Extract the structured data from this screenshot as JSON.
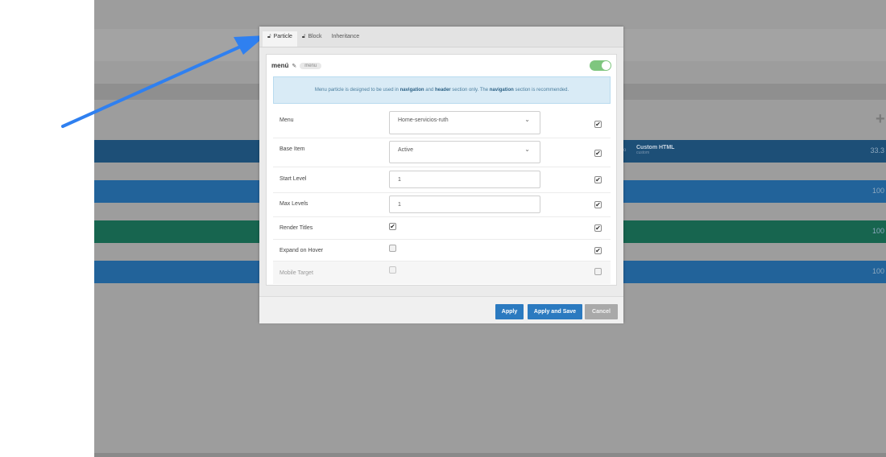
{
  "background": {
    "custom_html_title": "Custom HTML",
    "custom_html_sub": "custom",
    "cut_label": "o",
    "plus": "+",
    "row_values": [
      "33.3",
      "100",
      "100",
      "100"
    ]
  },
  "tabs": [
    {
      "label": "Particle",
      "icon": "lock-icon",
      "active": true
    },
    {
      "label": "Block",
      "icon": "lock-icon",
      "active": false
    },
    {
      "label": "Inheritance",
      "active": false
    }
  ],
  "header": {
    "title": "menú",
    "badge": "menu",
    "enabled": true
  },
  "info": {
    "prefix": "Menu particle is designed to be used in ",
    "b1": "navigation",
    "mid1": " and ",
    "b2": "header",
    "mid2": " section only. The ",
    "b3": "navigation",
    "suffix": " section is recommended."
  },
  "fields": {
    "menu": {
      "label": "Menu",
      "value": "Home-servicios-ruth",
      "override": true
    },
    "base_item": {
      "label": "Base Item",
      "value": "Active",
      "override": true
    },
    "start_level": {
      "label": "Start Level",
      "value": "1",
      "override": true
    },
    "max_levels": {
      "label": "Max Levels",
      "value": "1",
      "override": true
    },
    "render_titles": {
      "label": "Render Titles",
      "checked": true,
      "override": true
    },
    "expand_on_hover": {
      "label": "Expand on Hover",
      "checked": false,
      "override": true
    },
    "mobile_target": {
      "label": "Mobile Target",
      "checked": false,
      "override": false
    }
  },
  "footer": {
    "apply": "Apply",
    "apply_save": "Apply and Save",
    "cancel": "Cancel"
  },
  "colors": {
    "primary": "#2b7ac0",
    "toggle_on": "#7fc67f",
    "info_bg": "#d9ebf6"
  }
}
